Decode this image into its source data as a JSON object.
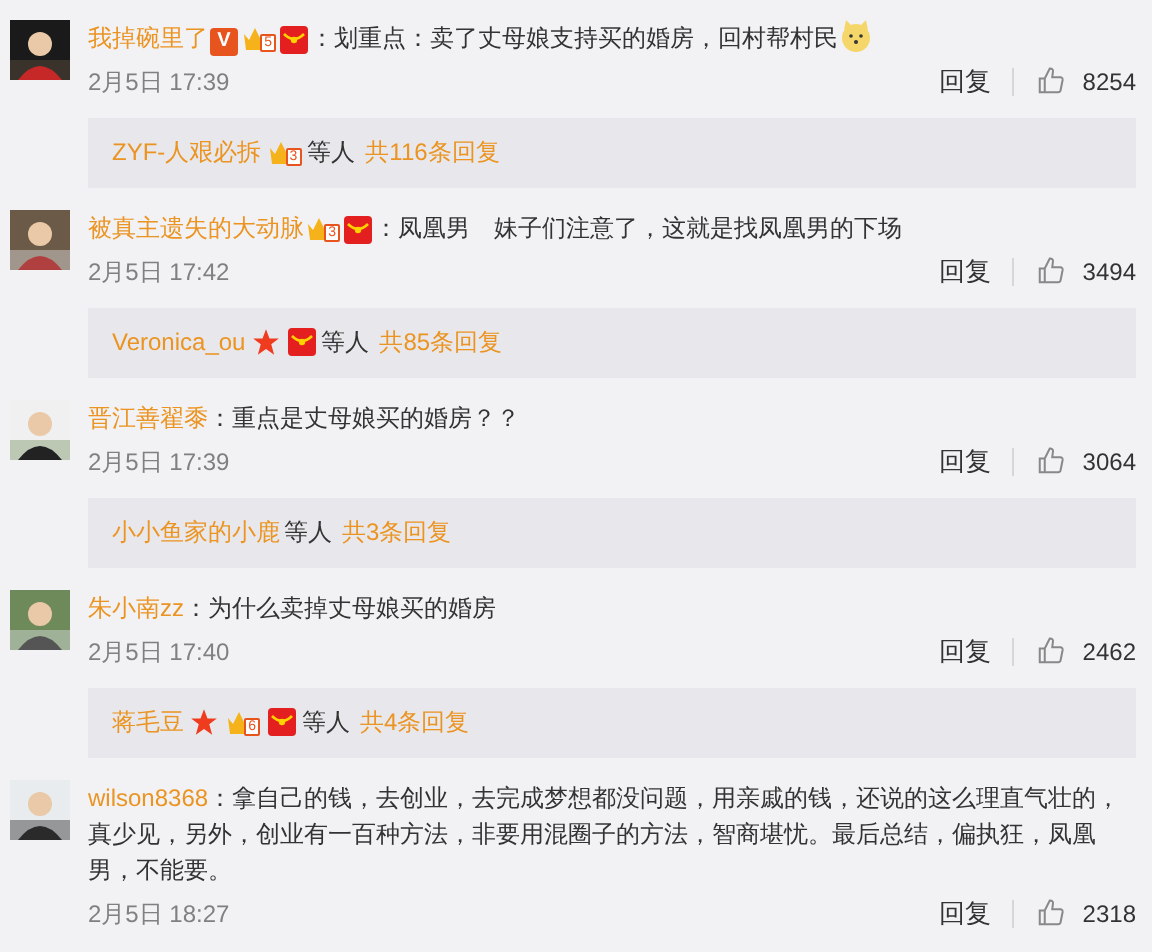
{
  "comments": [
    {
      "name": "我掉碗里了",
      "badges": [
        {
          "kind": "vip",
          "text": "V"
        },
        {
          "kind": "crown",
          "text": "5"
        },
        {
          "kind": "envelope"
        }
      ],
      "text": "：划重点：卖了丈母娘支持买的婚房，回村帮村民",
      "emojis": [
        {
          "kind": "dog"
        }
      ],
      "time": "2月5日 17:39",
      "reply": "回复",
      "likes": "8254",
      "thread": {
        "name": "ZYF-人艰必拆",
        "badges": [
          {
            "kind": "crown",
            "text": "3"
          }
        ],
        "others": "等人",
        "count": "共116条回复"
      }
    },
    {
      "name": "被真主遗失的大动脉",
      "badges": [
        {
          "kind": "crown",
          "text": "3"
        },
        {
          "kind": "envelope"
        }
      ],
      "text": "：凤凰男　妹子们注意了，这就是找凤凰男的下场",
      "time": "2月5日 17:42",
      "reply": "回复",
      "likes": "3494",
      "thread": {
        "name": "Veronica_ou",
        "badges": [
          {
            "kind": "star"
          },
          {
            "kind": "envelope"
          }
        ],
        "others": "等人",
        "count": "共85条回复"
      }
    },
    {
      "name": "晋江善翟黍",
      "text": "：重点是丈母娘买的婚房？？",
      "time": "2月5日 17:39",
      "reply": "回复",
      "likes": "3064",
      "thread": {
        "name": "小小鱼家的小鹿",
        "others": "等人",
        "count": "共3条回复"
      }
    },
    {
      "name": "朱小南zz",
      "text": "：为什么卖掉丈母娘买的婚房",
      "time": "2月5日 17:40",
      "reply": "回复",
      "likes": "2462",
      "thread": {
        "name": "蒋毛豆",
        "badges": [
          {
            "kind": "star"
          },
          {
            "kind": "crown",
            "text": "6"
          },
          {
            "kind": "envelope"
          }
        ],
        "others": "等人",
        "count": "共4条回复"
      }
    },
    {
      "name": "wilson8368",
      "text": "：拿自己的钱，去创业，去完成梦想都没问题，用亲戚的钱，还说的这么理直气壮的，真少见，另外，创业有一百种方法，非要用混圈子的方法，智商堪忧。最后总结，偏执狂，凤凰男，不能要。",
      "time": "2月5日 18:27",
      "reply": "回复",
      "likes": "2318"
    }
  ]
}
